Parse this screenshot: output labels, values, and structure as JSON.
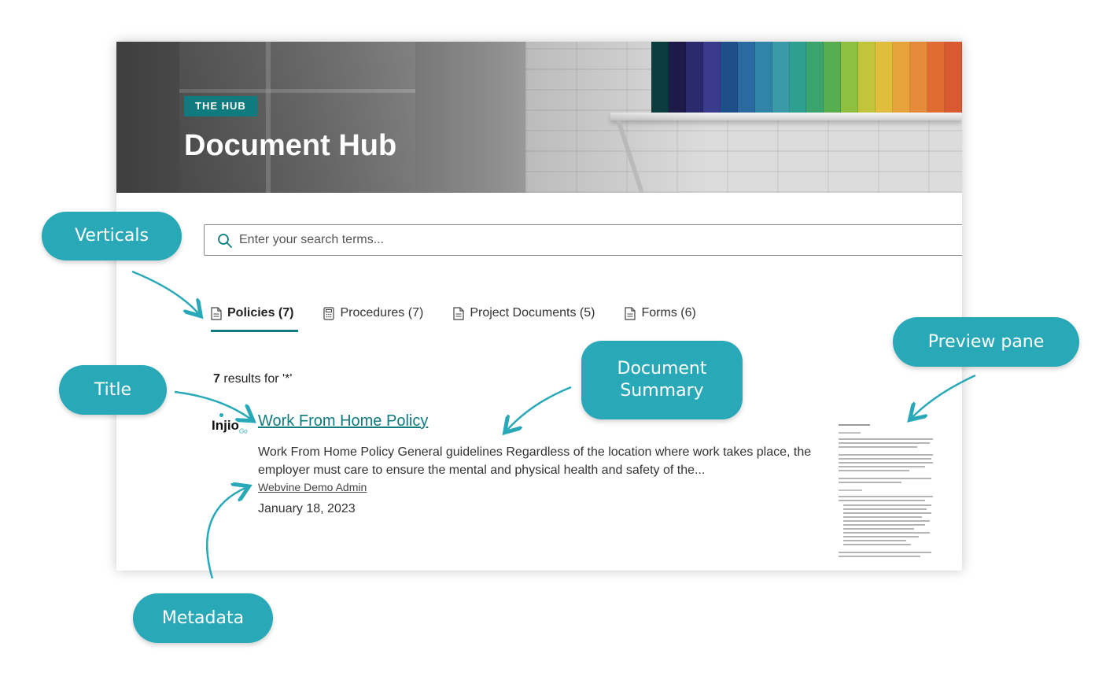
{
  "hero": {
    "tag": "THE HUB",
    "title": "Document Hub"
  },
  "search": {
    "placeholder": "Enter your search terms..."
  },
  "tabs": [
    {
      "label": "Policies (7)",
      "icon": "document-icon",
      "active": true
    },
    {
      "label": "Procedures (7)",
      "icon": "calculator-icon",
      "active": false
    },
    {
      "label": "Project Documents (5)",
      "icon": "document-icon",
      "active": false
    },
    {
      "label": "Forms (6)",
      "icon": "document-icon",
      "active": false
    }
  ],
  "results": {
    "count": "7",
    "query_text": "results for '*'"
  },
  "result_item": {
    "logo": "Injio",
    "logo_suffix": "Go",
    "title": "Work From Home Policy",
    "summary": "Work From Home Policy General guidelines Regardless of the location where work takes place, the employer must care to ensure the mental and physical health and safety of the...",
    "author": "Webvine Demo Admin",
    "date": "January 18, 2023"
  },
  "callouts": {
    "verticals": "Verticals",
    "title": "Title",
    "metadata": "Metadata",
    "summary_line1": "Document",
    "summary_line2": "Summary",
    "preview": "Preview pane"
  },
  "colors": {
    "accent": "#0f7b7f",
    "callout": "#29a9b8"
  }
}
